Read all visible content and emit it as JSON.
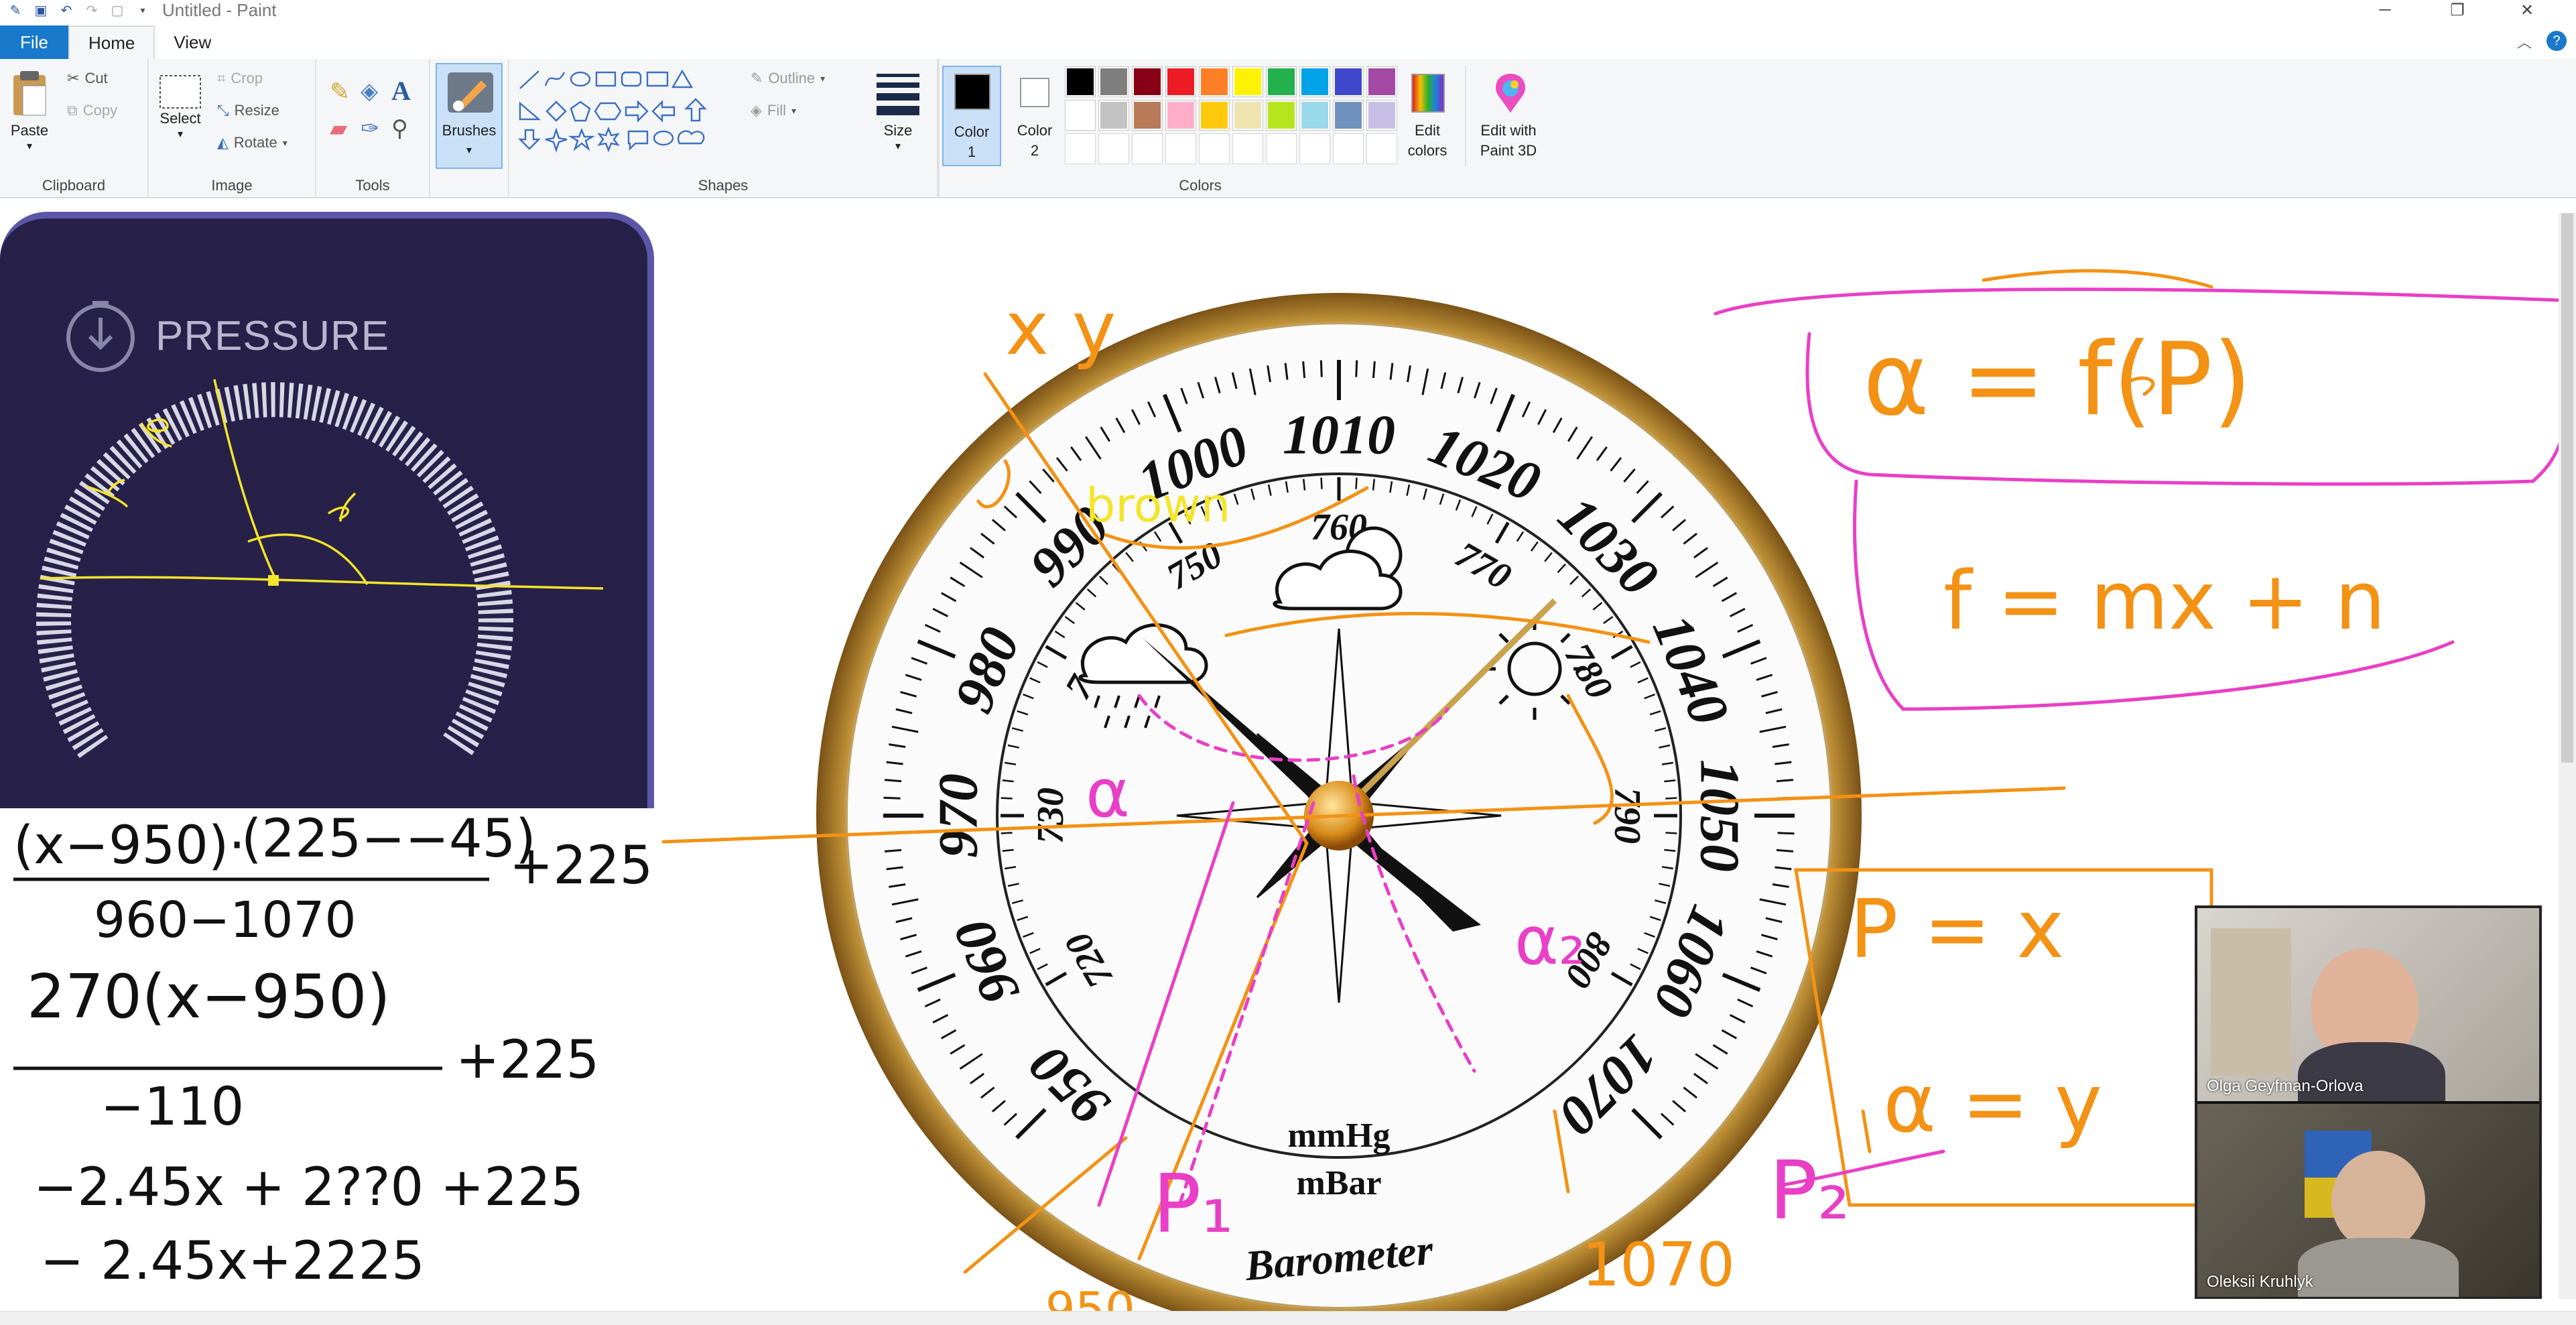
{
  "window": {
    "title": "Untitled - Paint",
    "controls": [
      "─",
      "❐",
      "✕"
    ]
  },
  "tabs": {
    "file": "File",
    "home": "Home",
    "view": "View"
  },
  "ribbon": {
    "clipboard": {
      "paste": "Paste",
      "cut": "Cut",
      "copy": "Copy",
      "label": "Clipboard"
    },
    "image": {
      "select": "Select",
      "crop": "Crop",
      "resize": "Resize",
      "rotate": "Rotate",
      "label": "Image"
    },
    "tools": {
      "label": "Tools"
    },
    "brushes": {
      "label": "Brushes"
    },
    "shapes": {
      "outline": "Outline",
      "fill": "Fill",
      "label": "Shapes"
    },
    "size": {
      "label": "Size"
    },
    "color1": {
      "label_a": "Color",
      "label_b": "1"
    },
    "color2": {
      "label_a": "Color",
      "label_b": "2"
    },
    "colors": {
      "label": "Colors",
      "row1": [
        "#000000",
        "#7f7f7f",
        "#880015",
        "#ed1c24",
        "#ff7f27",
        "#fff200",
        "#22b14c",
        "#00a2e8",
        "#3f48cc",
        "#a349a4"
      ],
      "row2": [
        "#ffffff",
        "#c3c3c3",
        "#b97a57",
        "#ffaec9",
        "#ffc90e",
        "#efe4b0",
        "#b5e61d",
        "#99d9ea",
        "#7092be",
        "#c8bfe7"
      ]
    },
    "edit_colors": {
      "label_a": "Edit",
      "label_b": "colors"
    },
    "paint3d": {
      "label_a": "Edit with",
      "label_b": "Paint 3D"
    }
  },
  "widget": {
    "title": "PRESSURE"
  },
  "barometer": {
    "outer_labels": [
      "950",
      "960",
      "970",
      "980",
      "990",
      "1000",
      "1010",
      "1020",
      "1030",
      "1040",
      "1050",
      "1060",
      "1070"
    ],
    "inner_labels": [
      "720",
      "730",
      "740",
      "750",
      "760",
      "770",
      "780",
      "790",
      "800"
    ],
    "unit1": "mmHg",
    "unit2": "mBar",
    "brand": "Barometer"
  },
  "handwriting": {
    "eq1_num_a": "(x−950)·",
    "eq1_num_b": "(225−−45)",
    "eq1_den": "960−1070",
    "eq1_plus": "+225",
    "eq2_num": "270(x−950)",
    "eq2_den": "−110",
    "eq2_plus": "+225",
    "eq3": "−2.45x + 2??0 +225",
    "eq4": "− 2.45x+2225",
    "alpha_eq": "α = f(P)",
    "f_eq": "f = mx + n",
    "p_eq": "P = x",
    "a_eq": "α = y",
    "p1": "P₁",
    "p2": "P₂",
    "a2": "α₂",
    "a1": "α",
    "brown": "brown",
    "xy": "x  y",
    "n950": "950",
    "n1070": "1070"
  },
  "participants": [
    {
      "name": "Olga Geyfman-Orlova"
    },
    {
      "name": "Oleksii Kruhlyk"
    }
  ]
}
